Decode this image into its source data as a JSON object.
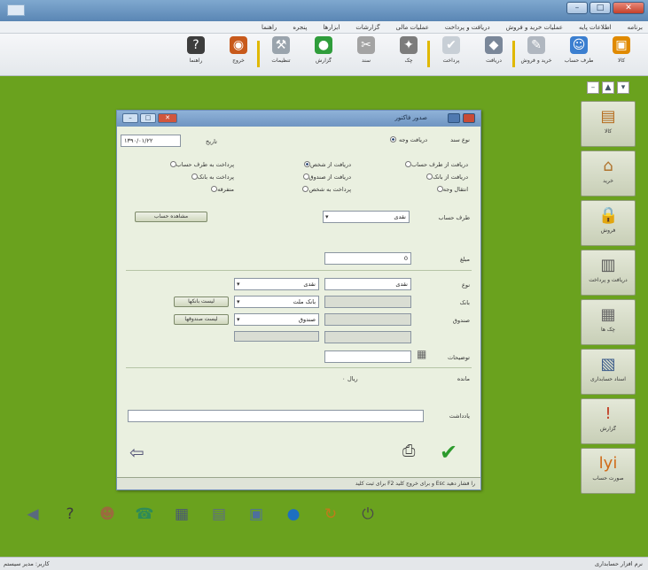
{
  "menu": [
    "برنامه",
    "اطلاعات پایه",
    "عملیات خرید و فروش",
    "دریافت و پرداخت",
    "عملیات مالی",
    "گزارشات",
    "ابزارها",
    "پنجره",
    "راهنما"
  ],
  "toolbar": [
    {
      "label": "کالا",
      "icon": "box-icon",
      "color": "#e08a00",
      "glyph": "▣"
    },
    {
      "label": "طرف حساب",
      "icon": "person-icon",
      "color": "#3b7fd0",
      "glyph": "☺"
    },
    {
      "label": "خرید و فروش",
      "icon": "cart-icon",
      "color": "#b0b7c0",
      "glyph": "✎"
    },
    {
      "label": "دریافت",
      "icon": "receive-icon",
      "color": "#7a8799",
      "glyph": "◆"
    },
    {
      "label": "پرداخت",
      "icon": "pay-icon",
      "color": "#c8cfd6",
      "glyph": "✔"
    },
    {
      "label": "چک",
      "icon": "check-icon",
      "color": "#7c7c7c",
      "glyph": "✦"
    },
    {
      "label": "سند",
      "icon": "doc-icon",
      "color": "#a3a3a3",
      "glyph": "✂"
    },
    {
      "label": "گزارش",
      "icon": "report-icon",
      "color": "#2f9d3b",
      "glyph": "●"
    },
    {
      "label": "تنظیمات",
      "icon": "tools-icon",
      "color": "#9aa4ad",
      "glyph": "⚒"
    },
    {
      "label": "خروج",
      "icon": "exit-icon",
      "color": "#c85a1c",
      "glyph": "◉"
    },
    {
      "label": "راهنما",
      "icon": "help-icon",
      "color": "#3d3d3d",
      "glyph": "?"
    }
  ],
  "side_panel": [
    {
      "label": "کالا",
      "icon": "book-icon",
      "glyph": "▤",
      "color": "#b56b1c"
    },
    {
      "label": "خرید",
      "icon": "basket-icon",
      "glyph": "⌂",
      "color": "#b0732c"
    },
    {
      "label": "فروش",
      "icon": "lock-icon",
      "glyph": "🔒",
      "color": "#b8621a"
    },
    {
      "label": "دریافت و پرداخت",
      "icon": "receipt-icon",
      "glyph": "▥",
      "color": "#555555"
    },
    {
      "label": "چک ها",
      "icon": "calendar-icon",
      "glyph": "▦",
      "color": "#666666"
    },
    {
      "label": "اسناد حسابداری",
      "icon": "ledger-icon",
      "glyph": "▧",
      "color": "#3a5a8a"
    },
    {
      "label": "گزارش",
      "icon": "pin-icon",
      "glyph": "!",
      "color": "#c0391f"
    },
    {
      "label": "صورت حساب",
      "icon": "invoice-icon",
      "glyph": "lyi",
      "color": "#d06a18"
    }
  ],
  "dialog": {
    "title": "صدور فاکتور",
    "date_label": "تاریخ",
    "date_value": "۱۳۹۰/۰۱/۲۲",
    "doc_type_label": "نوع سند",
    "doc_type_value": "دریافت وجه",
    "radios": [
      "دریافت از طرف حساب",
      "دریافت از شخص",
      "پرداخت به طرف حساب",
      "دریافت از بانک",
      "دریافت از صندوق",
      "پرداخت به بانک",
      "انتقال وجه",
      "پرداخت به شخص",
      "متفرقه"
    ],
    "party_label": "طرف حساب",
    "party_value": "نقدی",
    "party_button": "مشاهده حساب",
    "amount_label": "مبلغ",
    "amount_value": "0",
    "method_label": "نوع",
    "method_value": "نقدی",
    "bank_label": "بانک",
    "bank_value": "بانک ملت",
    "bank_button": "لیست بانکها",
    "cashbox_label": "صندوق",
    "cashbox_value": "صندوق",
    "cashbox_button": "لیست صندوقها",
    "desc_label": "توضیحات",
    "desc_value": "",
    "total_label": "مانده",
    "total_value": "۰",
    "total_unit": "ریال",
    "note_label": "یادداشت",
    "status_text": "برای ثبت کلید F2 و برای خروج کلید Esc را فشار دهید"
  },
  "statusbar": {
    "left": "کاربر: مدیر سیستم",
    "right": "نرم افزار حسابداری"
  }
}
